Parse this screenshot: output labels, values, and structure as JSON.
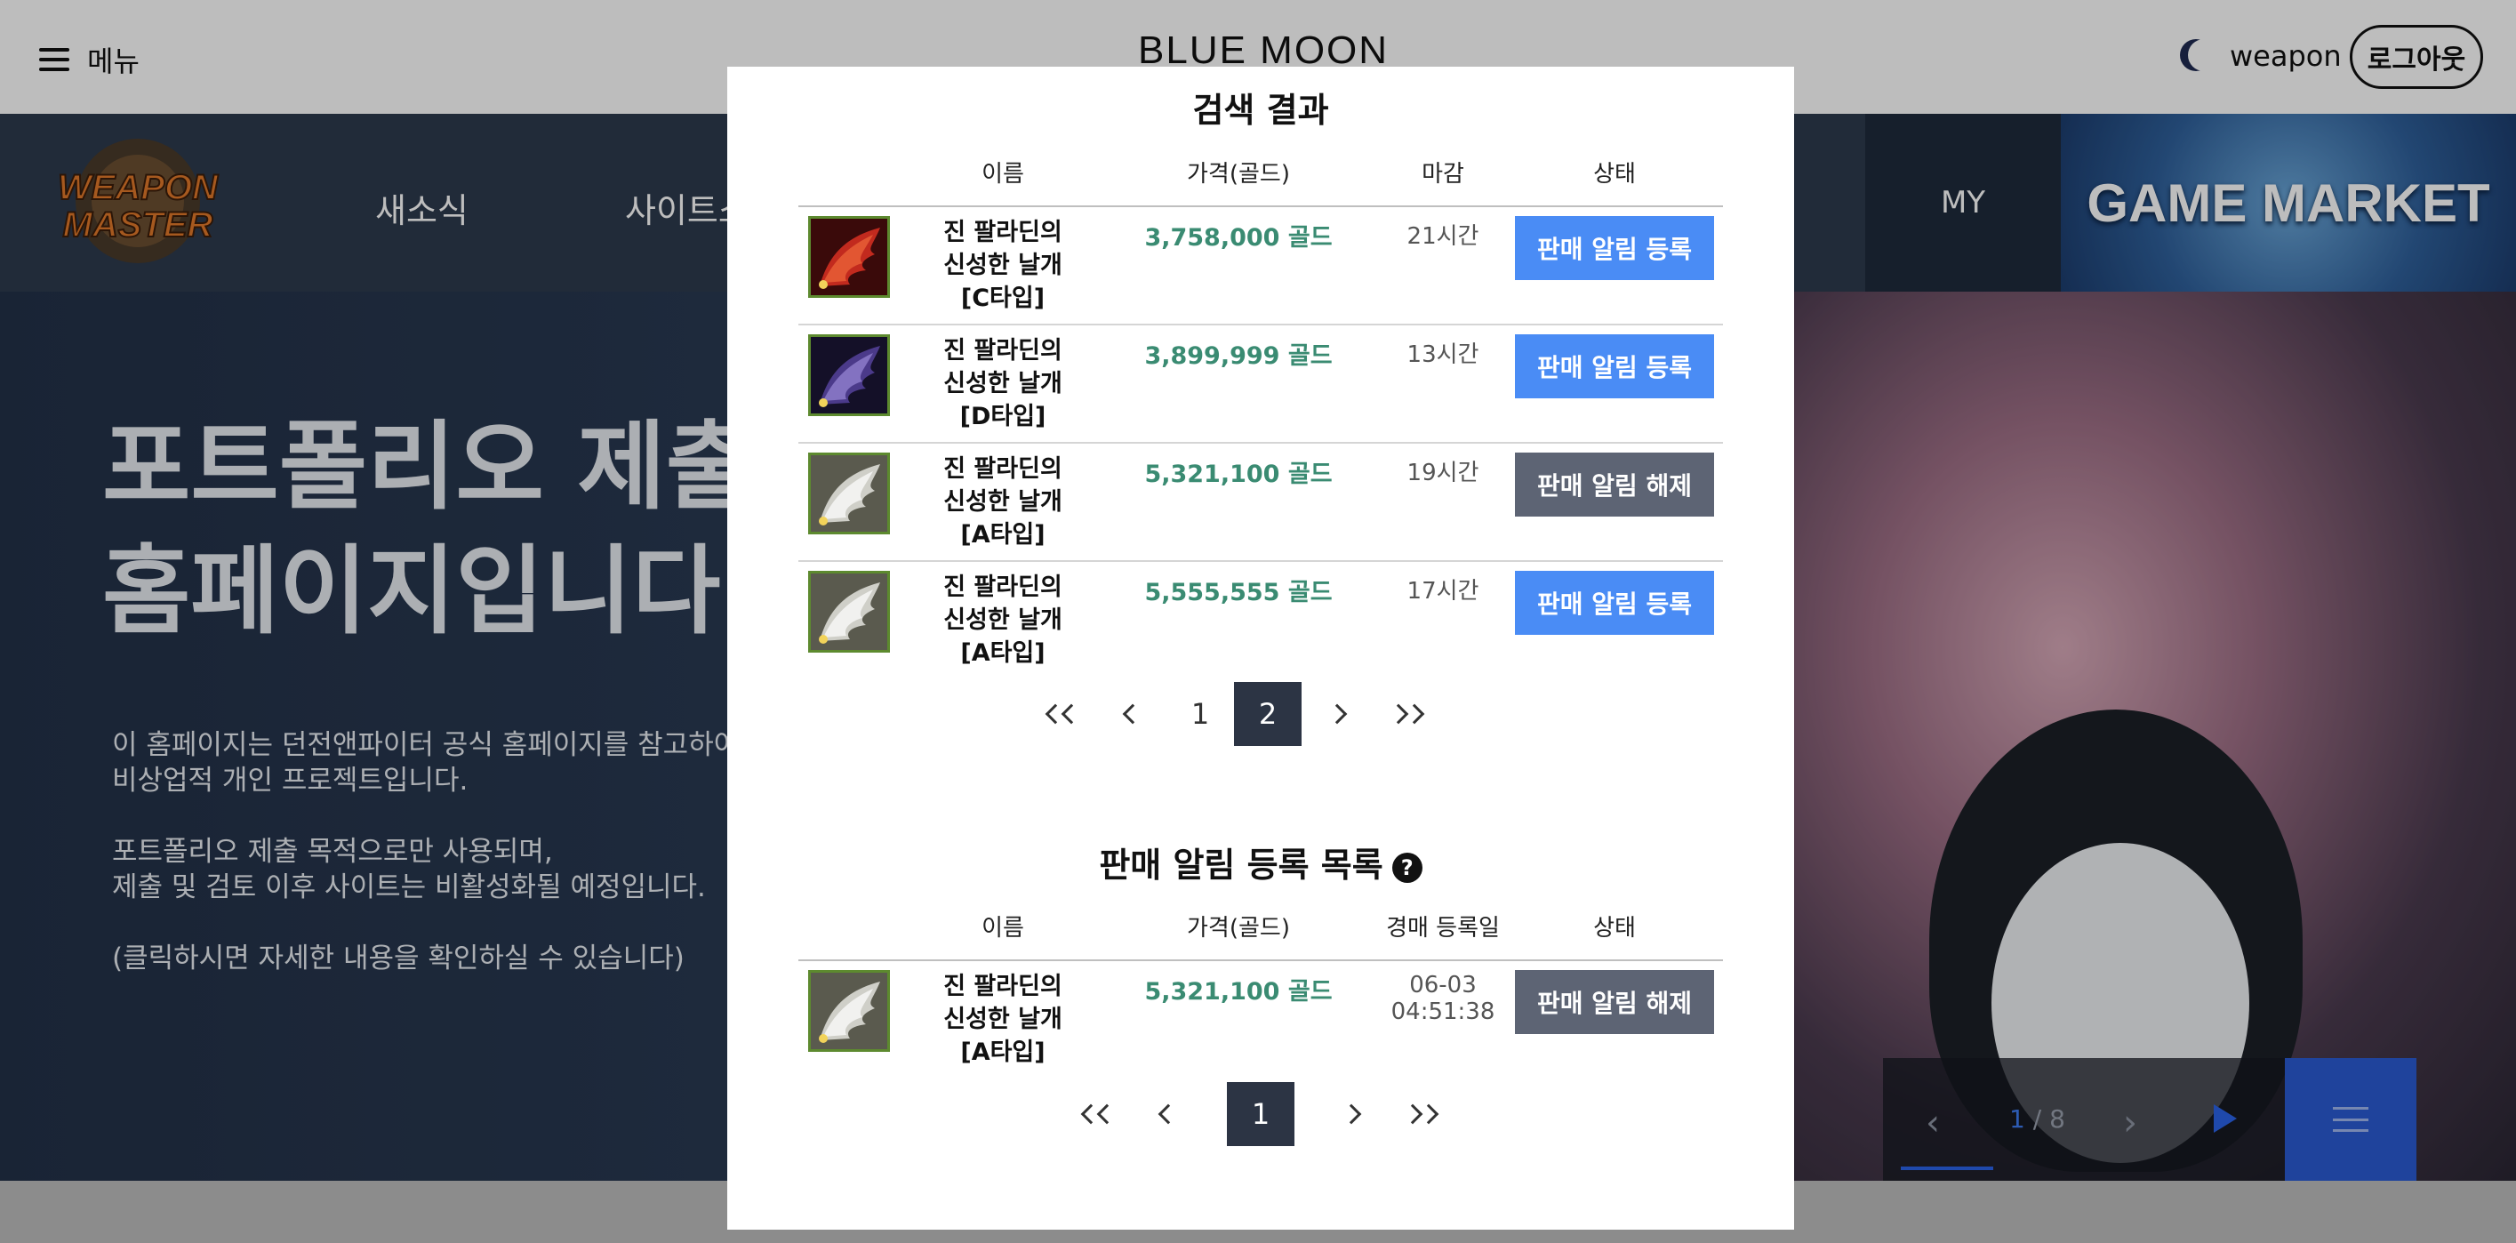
{
  "header": {
    "menu_label": "메뉴",
    "site_title": "BLUE MOON",
    "user_name": "weapon",
    "logout_label": "로그아웃"
  },
  "nav": {
    "items": [
      "새소식",
      "사이트소"
    ],
    "my_label": "MY",
    "game_market_label": "GAME MARKET"
  },
  "hero": {
    "title": "포트폴리오 제출\n홈페이지입니다",
    "paragraphs": [
      "이 홈페이지는 던전앤파이터 공식 홈페이지를 참고하여\n비상업적 개인 프로젝트입니다.",
      "포트폴리오 제출 목적으로만 사용되며,\n제출 및 검토 이후 사이트는 비활성화될 예정입니다.",
      "(클릭하시면 자세한 내용을 확인하실 수 있습니다)"
    ],
    "slider": {
      "current": "1",
      "total": "/ 8"
    }
  },
  "search_results": {
    "title": "검색 결과",
    "columns": {
      "name": "이름",
      "price": "가격(골드)",
      "deadline": "마감",
      "status": "상태"
    },
    "rows": [
      {
        "name": "진 팔라딘의 신성한 날개[C타입]",
        "price": "3,758,000 골드",
        "time": "21시간",
        "status": "판매 알림 등록",
        "status_type": "register",
        "icon": "red-wing-icon"
      },
      {
        "name": "진 팔라딘의 신성한 날개[D타입]",
        "price": "3,899,999 골드",
        "time": "13시간",
        "status": "판매 알림 등록",
        "status_type": "register",
        "icon": "purple-wing-icon"
      },
      {
        "name": "진 팔라딘의 신성한 날개[A타입]",
        "price": "5,321,100 골드",
        "time": "19시간",
        "status": "판매 알림 해제",
        "status_type": "release",
        "icon": "white-wing-icon"
      },
      {
        "name": "진 팔라딘의 신성한 날개[A타입]",
        "price": "5,555,555 골드",
        "time": "17시간",
        "status": "판매 알림 등록",
        "status_type": "register",
        "icon": "white-wing-icon"
      }
    ],
    "pagination": {
      "pages": [
        "1",
        "2"
      ],
      "active": "2"
    }
  },
  "registered": {
    "title": "판매 알림 등록 목록",
    "help_symbol": "?",
    "columns": {
      "name": "이름",
      "price": "가격(골드)",
      "date": "경매 등록일",
      "status": "상태"
    },
    "rows": [
      {
        "name": "진 팔라딘의 신성한 날개[A타입]",
        "price": "5,321,100 골드",
        "date": "06-03 04:51:38",
        "status": "판매 알림 해제",
        "status_type": "release",
        "icon": "white-wing-icon"
      }
    ],
    "pagination": {
      "pages": [
        "1"
      ],
      "active": "1"
    }
  },
  "colors": {
    "price_green": "#3a8b72",
    "register_blue": "#4a8cf5",
    "release_gray": "#5d6474",
    "pager_active": "#2c3444"
  }
}
